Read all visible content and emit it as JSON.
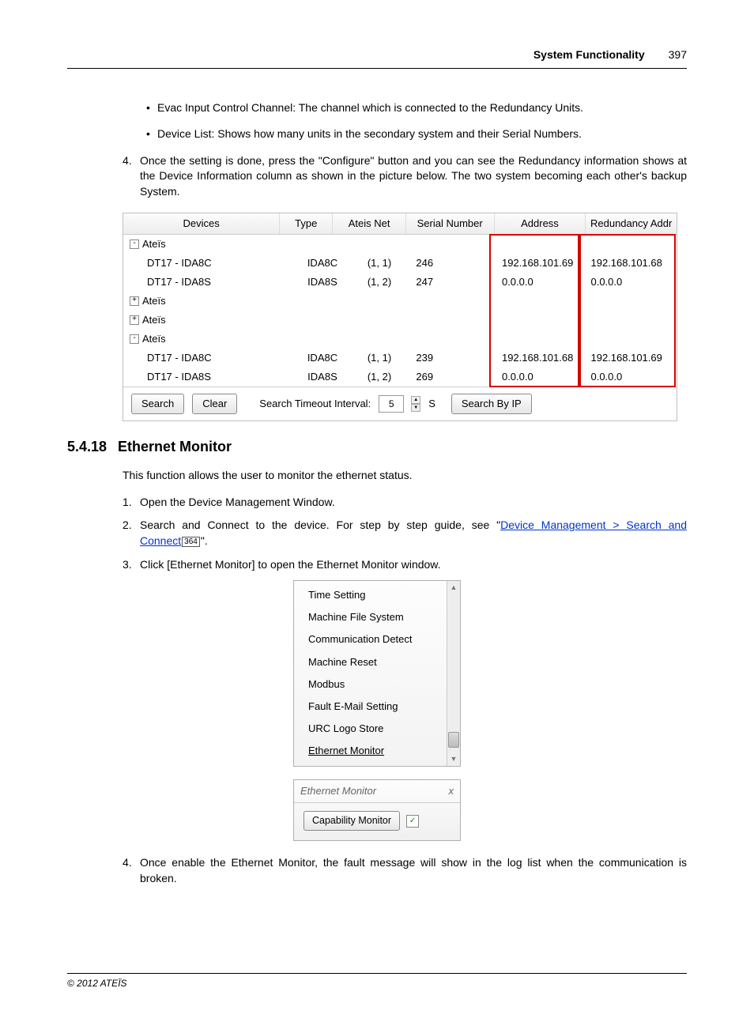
{
  "header": {
    "title": "System Functionality",
    "page": "397"
  },
  "bullets": [
    "Evac Input Control Channel: The channel which is connected to the Redundancy Units.",
    "Device List: Shows how many units in the secondary system and their Serial Numbers."
  ],
  "step4top_num": "4.",
  "step4top": "Once the setting is done, press the \"Configure\" button and you can see the Redundancy information shows at the Device Information column as shown in the picture below. The two system becoming each other's backup System.",
  "table": {
    "headers": {
      "devices": "Devices",
      "type": "Type",
      "net": "Ateis Net",
      "sn": "Serial Number",
      "addr": "Address",
      "raddr": "Redundancy Addr"
    },
    "rows": [
      {
        "kind": "group",
        "toggle": "-",
        "label": "Ateïs"
      },
      {
        "kind": "leaf",
        "dev": "DT17 - IDA8C",
        "type": "IDA8C",
        "net": "(1, 1)",
        "sn": "246",
        "addr": "192.168.101.69",
        "raddr": "192.168.101.68"
      },
      {
        "kind": "leaf",
        "dev": "DT17 - IDA8S",
        "type": "IDA8S",
        "net": "(1, 2)",
        "sn": "247",
        "addr": "0.0.0.0",
        "raddr": "0.0.0.0"
      },
      {
        "kind": "group",
        "toggle": "+",
        "label": "Ateïs"
      },
      {
        "kind": "group",
        "toggle": "+",
        "label": "Ateïs"
      },
      {
        "kind": "group",
        "toggle": "-",
        "label": "Ateïs"
      },
      {
        "kind": "leaf",
        "dev": "DT17 - IDA8C",
        "type": "IDA8C",
        "net": "(1, 1)",
        "sn": "239",
        "addr": "192.168.101.68",
        "raddr": "192.168.101.69"
      },
      {
        "kind": "leaf",
        "dev": "DT17 - IDA8S",
        "type": "IDA8S",
        "net": "(1, 2)",
        "sn": "269",
        "addr": "0.0.0.0",
        "raddr": "0.0.0.0"
      }
    ],
    "footer": {
      "search": "Search",
      "clear": "Clear",
      "timeout_label": "Search Timeout Interval:",
      "timeout_val": "5",
      "unit": "S",
      "byip": "Search By IP"
    }
  },
  "section": {
    "num": "5.4.18",
    "title": "Ethernet Monitor"
  },
  "intro": "This function allows the user to monitor the ethernet status.",
  "steps": {
    "1": {
      "num": "1.",
      "txt": "Open the Device Management Window."
    },
    "2": {
      "num": "2.",
      "pre": "Search and Connect to the device. For step by step guide, see \"",
      "link": "Device Management > Search and Connect",
      "ref": "364",
      "post": "\"."
    },
    "3": {
      "num": "3.",
      "txt": "Click [Ethernet Monitor] to open the Ethernet Monitor window."
    },
    "4": {
      "num": "4.",
      "txt": "Once enable the Ethernet Monitor, the fault message will show in the log list when the communication is broken."
    }
  },
  "menu": {
    "items": [
      "Time Setting",
      "Machine File System",
      "Communication Detect",
      "Machine Reset",
      "Modbus",
      "Fault E-Mail Setting",
      "URC Logo Store",
      "Ethernet Monitor"
    ]
  },
  "em_panel": {
    "title": "Ethernet Monitor",
    "close": "x",
    "btn": "Capability Monitor",
    "check": "✓"
  },
  "footer": "© 2012 ATEÏS"
}
